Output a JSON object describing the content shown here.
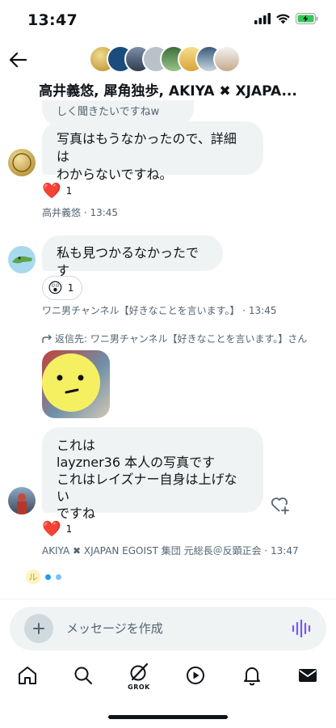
{
  "status_bar": {
    "time": "13:47",
    "icons": [
      "signal-icon",
      "wifi-icon",
      "battery-charging-icon"
    ]
  },
  "header": {
    "back_icon": "arrow-left-icon",
    "group_name": "高井義悠, 犀角独歩, AKIYA ✖ XJAPA...",
    "avatars": [
      "avatar-1",
      "avatar-2",
      "avatar-3",
      "avatar-4",
      "avatar-5",
      "avatar-6",
      "avatar-7",
      "avatar-8"
    ]
  },
  "messages": {
    "partial_text": "しく聞きたいですねw",
    "m1": {
      "text_line1": "写真はもうなかったので、詳細は",
      "text_line2": "わからないですね。",
      "reaction_emoji": "❤️",
      "reaction_count": "1",
      "meta": "高井義悠 · 13:45"
    },
    "m2": {
      "text": "私も見つかるなかったです",
      "reaction_emoji": "😲",
      "reaction_count": "1",
      "meta": "ワニ男チャンネル【好きなことを言います。】 · 13:45"
    },
    "m3": {
      "reply_to": "返信先: ワニ男チャンネル【好きなことを言います。】さん",
      "text_line1": "これは",
      "text_line2": "layzner36 本人の写真です",
      "text_line3": "これはレイズナー自身は上げない",
      "text_line4": "ですね",
      "reaction_emoji": "❤️",
      "reaction_count": "1",
      "meta": "AKIYA ✖ XJAPAN EGOIST 集団 元総長＠反顕正会 · 13:47"
    },
    "typing_avatar_text": "ル"
  },
  "composer": {
    "placeholder": "メッセージを作成",
    "plus_icon": "plus-icon",
    "voice_icon": "voice-waveform-icon"
  },
  "tab_bar": {
    "items": [
      "home-icon",
      "search-icon",
      "grok-icon",
      "play-icon",
      "bell-icon",
      "mail-icon"
    ],
    "grok_label": "GROK"
  },
  "colors": {
    "accent": "#1d9bf0",
    "bubble": "#eff3f4",
    "text_secondary": "#536471",
    "voice": "#7856ff"
  }
}
